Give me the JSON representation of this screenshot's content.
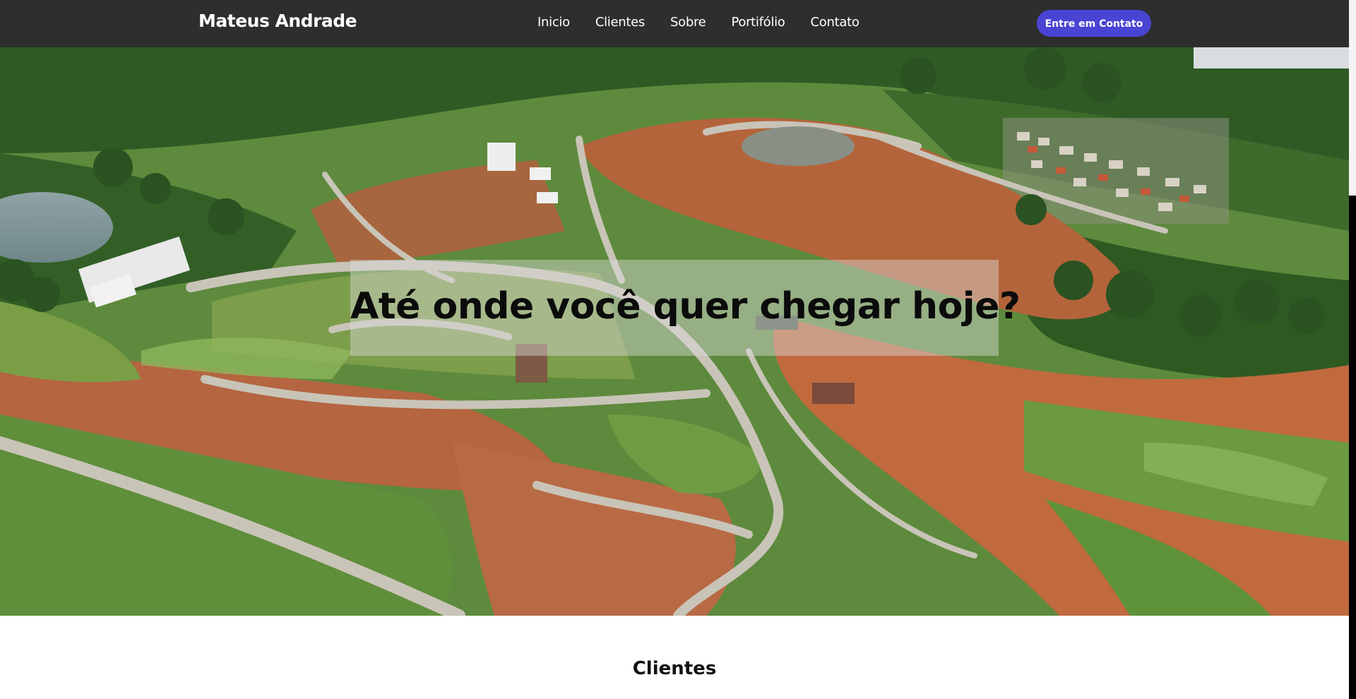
{
  "navbar": {
    "brand": "Mateus Andrade",
    "links": [
      "Inicio",
      "Clientes",
      "Sobre",
      "Portifólio",
      "Contato"
    ],
    "cta_label": "Entre em Contato"
  },
  "hero": {
    "title": "Até onde você quer chegar hoje?",
    "image_alt": "aerial-view-land-development"
  },
  "clients": {
    "title": "Clientes"
  },
  "colors": {
    "navbar_bg": "#2e2e2e",
    "cta_bg": "#4a44d4",
    "text_light": "#ffffff",
    "text_dark": "#111111"
  }
}
